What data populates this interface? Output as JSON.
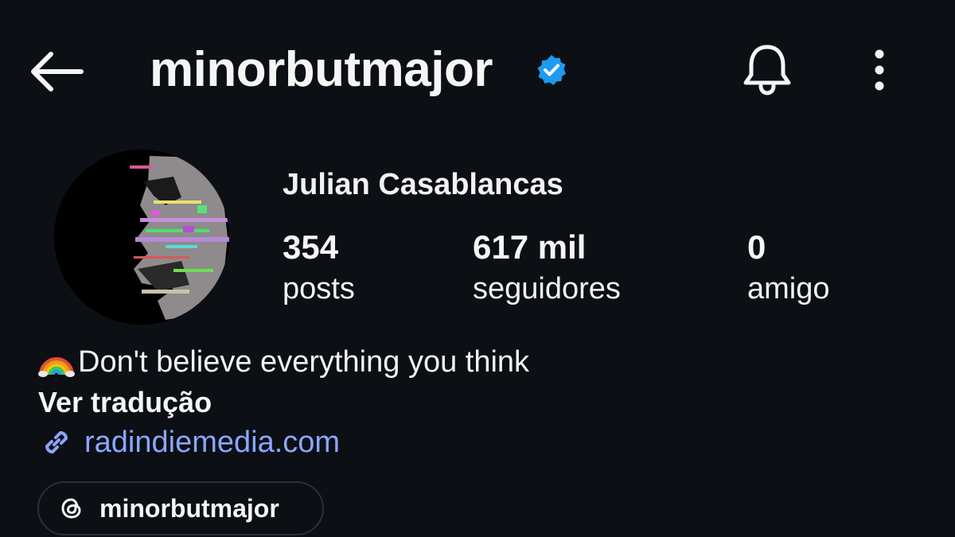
{
  "header": {
    "back_icon": "arrow-left-icon",
    "username": "minorbutmajor",
    "verified_icon": "verified-badge-icon",
    "bell_icon": "bell-icon",
    "more_icon": "more-vertical-icon"
  },
  "profile": {
    "full_name": "Julian Casablancas",
    "stats": {
      "posts": {
        "value": "354",
        "label": "posts"
      },
      "followers": {
        "value": "617 mil",
        "label": "seguidores"
      },
      "friends": {
        "value": "0",
        "label": "amigo"
      }
    },
    "bio": "Don't believe everything you think",
    "bio_emoji": "rainbow",
    "translate_label": "Ver tradução",
    "link": "radindiemedia.com",
    "threads_chip": "minorbutmajor"
  },
  "colors": {
    "background": "#0c0f14",
    "verified_blue": "#1d9bf0",
    "link_blue": "#8aa6ff"
  }
}
